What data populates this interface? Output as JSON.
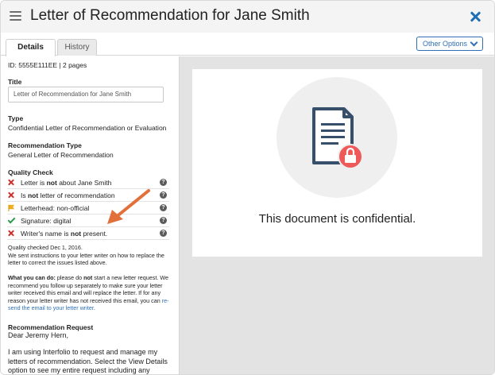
{
  "header": {
    "title": "Letter of Recommendation for Jane Smith"
  },
  "tabs": [
    {
      "label": "Details"
    },
    {
      "label": "History"
    }
  ],
  "options_label": "Other Options",
  "details": {
    "id_line": "ID: 5555E111EE | 2 pages",
    "title_label": "Title",
    "title_value": "Letter of Recommendation for Jane Smith",
    "type_label": "Type",
    "type_value": "Confidential Letter of Recommendation or Evaluation",
    "rec_type_label": "Recommendation Type",
    "rec_type_value": "General Letter of Recommendation",
    "quality_label": "Quality Check",
    "quality_items": [
      {
        "status": "fail",
        "pre": "Letter is ",
        "bold": "not",
        "post": " about Jane Smith"
      },
      {
        "status": "fail",
        "pre": "Is ",
        "bold": "not",
        "post": " letter of recommendation"
      },
      {
        "status": "warn",
        "pre": "Letterhead: non-official",
        "bold": "",
        "post": ""
      },
      {
        "status": "pass",
        "pre": "Signature: digital",
        "bold": "",
        "post": ""
      },
      {
        "status": "fail",
        "pre": "Writer's name is ",
        "bold": "not",
        "post": " present."
      }
    ],
    "checked_line": "Quality checked Dec 1, 2016.",
    "instructions_1": "We sent instructions to your letter writer on how to replace the",
    "instructions_2": "letter to correct the issues listed above.",
    "what_bold": "What you can do:",
    "what_1_rest": " please do ",
    "what_1_bold2": "not",
    "what_1_end": " start a new letter request.  We",
    "what_2": "recommend you follow up separately to make sure your letter",
    "what_3": "writer received this email and will replace the letter. If for any",
    "what_4_pre": "reason your letter writer has not received this email, you can ",
    "what_4_link": "re-",
    "what_5_link": "send the email to your letter writer",
    "what_5_end": ".",
    "request_label": "Recommendation Request",
    "request_greeting": "Dear Jeremy Hern,",
    "request_body_1": "I am using Interfolio to request and manage my",
    "request_body_2": "letters of recommendation. Select the View Details",
    "request_body_3": "option to see my entire request including any"
  },
  "preview": {
    "message": "This document is confidential."
  },
  "colors": {
    "accent": "#2e6fb6",
    "fail": "#c9302c",
    "warn": "#f0ad1b",
    "pass": "#2e9d52",
    "lock": "#ee5a5a",
    "annotation_arrow": "#e2703a"
  },
  "icons": {
    "menu": "hamburger-icon",
    "close": "close-icon",
    "document": "locked-document-icon"
  }
}
